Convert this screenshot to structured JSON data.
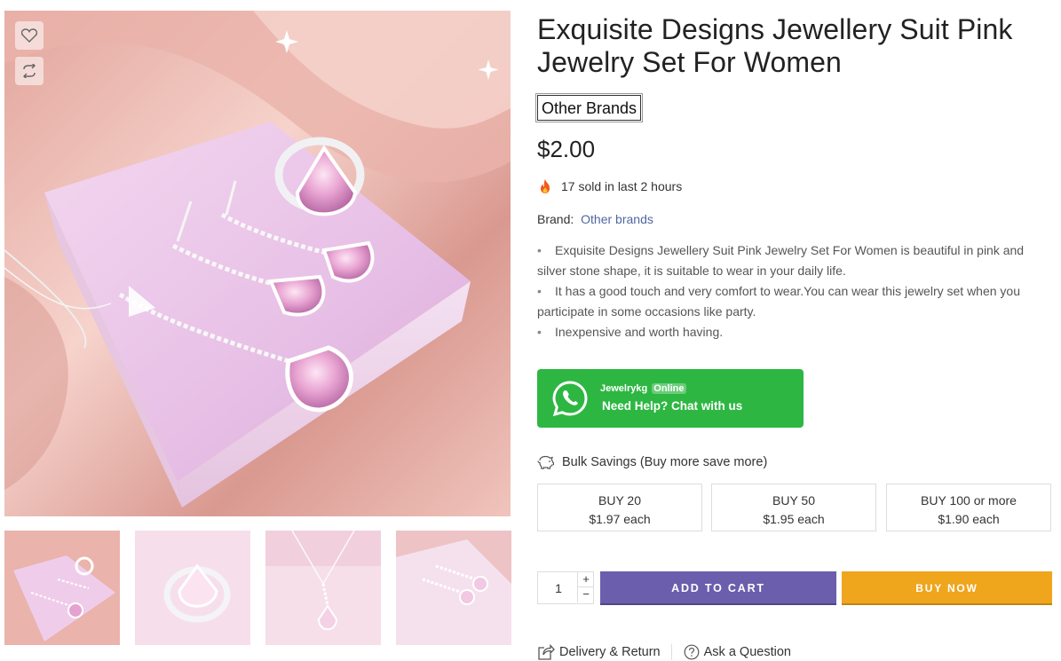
{
  "product": {
    "title": "Exquisite Designs Jewellery Suit Pink Jewelry Set For Women",
    "brand_tag": "Other Brands",
    "price": "$2.00",
    "sold_text": "17 sold in last 2 hours",
    "brand_label": "Brand:",
    "brand_value": "Other brands",
    "description": [
      "Exquisite Designs Jewellery Suit Pink Jewelry Set For Women is beautiful in pink and silver stone shape, it is suitable to wear in your daily life.",
      "It has a good touch and very comfort to wear.You can wear this jewelry set when you participate in some occasions like party.",
      "Inexpensive and worth having."
    ],
    "bullet": "•"
  },
  "gallery": {
    "icons": [
      "heart-icon",
      "compare-icon"
    ],
    "thumbnail_count": 4
  },
  "whatsapp": {
    "name": "Jewelrykg",
    "status": "Online",
    "cta": "Need Help? Chat with us",
    "color": "#2db742"
  },
  "bulk": {
    "title": "Bulk Savings (Buy more save more)",
    "tiers": [
      {
        "label": "BUY 20",
        "price": "$1.97 each"
      },
      {
        "label": "BUY 50",
        "price": "$1.95 each"
      },
      {
        "label": "BUY 100 or more",
        "price": "$1.90 each"
      }
    ]
  },
  "cart": {
    "quantity": "1",
    "plus": "+",
    "minus": "−",
    "add_to_cart": "ADD TO CART",
    "buy_now": "BUY NOW",
    "add_color": "#6b5ead",
    "buy_color": "#efa51c"
  },
  "links": {
    "delivery": "Delivery & Return",
    "ask": "Ask a Question"
  }
}
